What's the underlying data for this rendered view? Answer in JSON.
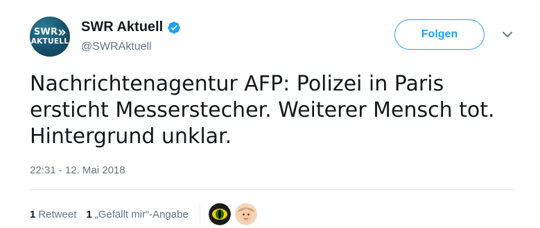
{
  "author": {
    "display_name": "SWR Aktuell",
    "handle": "@SWRAktuell",
    "avatar_line1": "SWR",
    "avatar_line2": "AKTUELL",
    "verified": true
  },
  "actions": {
    "follow_label": "Folgen",
    "more_icon": "chevron-down-icon"
  },
  "tweet": {
    "text_line1": "Nachrichtenagentur AFP: Polizei in Paris",
    "text_line2": "ersticht Messerstecher. Weiterer Mensch tot.",
    "text_line3": "Hintergrund unklar.",
    "timestamp": "22:31 - 12. Mai 2018"
  },
  "stats": {
    "retweet_count": "1",
    "retweet_label": "Retweet",
    "like_count": "1",
    "like_label": "„Gefällt mir“-Angabe"
  },
  "likers": [
    {
      "icon": "green-eye-avatar"
    },
    {
      "icon": "person-avatar"
    }
  ],
  "colors": {
    "accent": "#1da1f2",
    "secondary_text": "#657786",
    "primary_text": "#14171a",
    "divider": "#e6ecf0",
    "avatar_bg": "#15506a"
  }
}
